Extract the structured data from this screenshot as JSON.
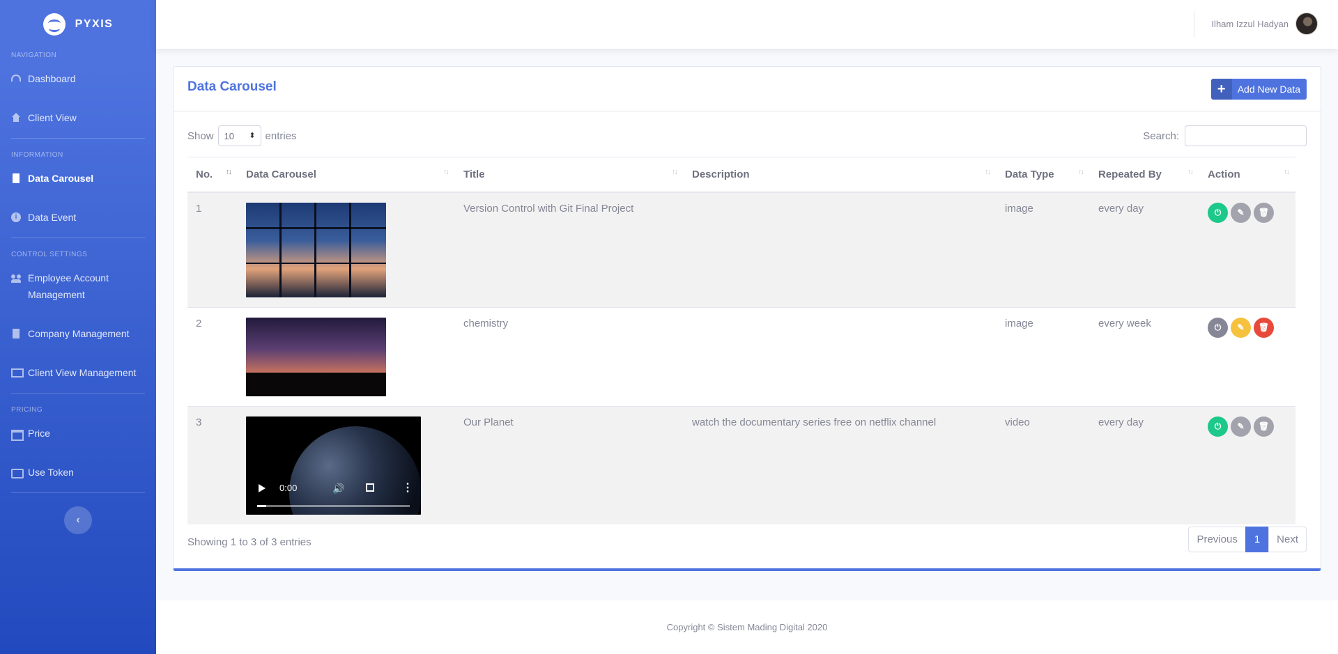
{
  "brand": {
    "name": "PYXIS"
  },
  "sidebar": {
    "sections": [
      {
        "heading": "Navigation"
      },
      {
        "heading": "Information"
      },
      {
        "heading": "Control Settings"
      },
      {
        "heading": "Pricing"
      }
    ],
    "items": [
      {
        "label": "Dashboard",
        "icon": "tachometer-icon"
      },
      {
        "label": "Client View",
        "icon": "home-icon"
      },
      {
        "label": "Data Carousel",
        "icon": "file-icon",
        "active": true
      },
      {
        "label": "Data Event",
        "icon": "info-icon"
      },
      {
        "label": "Employee Account Management",
        "icon": "users-icon"
      },
      {
        "label": "Company Management",
        "icon": "building-icon"
      },
      {
        "label": "Client View Management",
        "icon": "desktop-icon"
      },
      {
        "label": "Price",
        "icon": "table-icon"
      },
      {
        "label": "Use Token",
        "icon": "credit-card-icon"
      }
    ],
    "toggle": "‹"
  },
  "topbar": {
    "user_name": "Ilham Izzul Hadyan"
  },
  "card": {
    "title": "Data Carousel",
    "add_button": {
      "icon": "+",
      "label": "Add New Data"
    }
  },
  "table_controls": {
    "show_label": "Show",
    "entries_value": "10",
    "entries_label": "entries",
    "search_label": "Search:",
    "search_value": ""
  },
  "table": {
    "columns": [
      "No.",
      "Data Carousel",
      "Title",
      "Description",
      "Data Type",
      "Repeated By",
      "Action"
    ],
    "rows": [
      {
        "no": "1",
        "title": "Version Control with Git Final Project",
        "description": "",
        "data_type": "image",
        "repeated_by": "every day",
        "status": "active"
      },
      {
        "no": "2",
        "title": "chemistry",
        "description": "",
        "data_type": "image",
        "repeated_by": "every week",
        "status": "inactive"
      },
      {
        "no": "3",
        "title": "Our Planet",
        "description": "watch the documentary series free on netflix channel",
        "data_type": "video",
        "repeated_by": "every day",
        "status": "active",
        "video": {
          "time": "0:00",
          "progress": 0.06
        }
      }
    ]
  },
  "footer_info": "Showing 1 to 3 of 3 entries",
  "pagination": {
    "previous": "Previous",
    "current": "1",
    "next": "Next"
  },
  "footer": "Copyright © Sistem Mading Digital 2020",
  "colors": {
    "primary": "#4e73df",
    "success": "#1cc88a",
    "warning": "#f6c23e",
    "danger": "#e74a3b",
    "secondary": "#858796"
  }
}
